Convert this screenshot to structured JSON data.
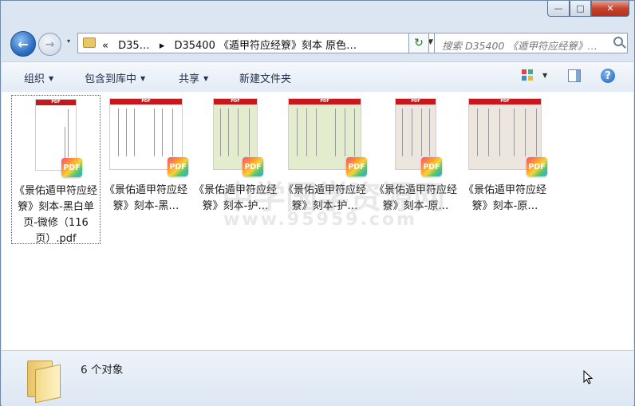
{
  "window": {
    "min_label": "—",
    "max_label": "□",
    "close_label": "✕"
  },
  "nav": {
    "back_icon": "back-arrow-icon",
    "forward_icon": "forward-arrow-icon",
    "history_icon": "▾",
    "breadcrumb_overflow": "«",
    "crumbs": [
      "D35…",
      "▸",
      "D35400 《遁甲符应经簝》刻本 原色…"
    ],
    "address_dropdown": "▼",
    "refresh_icon": "↻",
    "search_placeholder": "搜索 D35400 《遁甲符应经簝》…"
  },
  "toolbar": {
    "organize": "组织",
    "include_library": "包含到库中",
    "share": "共享",
    "new_folder": "新建文件夹",
    "view_arrow": "▼",
    "help": "?"
  },
  "files": [
    {
      "label": "《景佑遁甲符应经簝》刻本-黑白单页-微修（116页）.pdf",
      "thumb": "bw",
      "selected": true
    },
    {
      "label": "《景佑遁甲符应经簝》刻本-黑…",
      "thumb": "bw-wide",
      "selected": false
    },
    {
      "label": "《景佑遁甲符应经簝》刻本-护…",
      "thumb": "green",
      "selected": false
    },
    {
      "label": "《景佑遁甲符应经簝》刻本-护…",
      "thumb": "green-wide",
      "selected": false
    },
    {
      "label": "《景佑遁甲符应经簝》刻本-原…",
      "thumb": "orig",
      "selected": false
    },
    {
      "label": "《景佑遁甲符应经簝》刻本-原…",
      "thumb": "orig-wide",
      "selected": false
    }
  ],
  "pdf_badge": "PDF",
  "thumb_header": "PDF",
  "watermark": {
    "cn": "中学国学资源网",
    "url": "www.95959.com"
  },
  "status": {
    "count": "6 个对象"
  },
  "colors": {
    "accent": "#2d6fc2",
    "pdf_red": "#c9171e",
    "green_page": "#e3eccd",
    "orig_page": "#ece6df"
  }
}
